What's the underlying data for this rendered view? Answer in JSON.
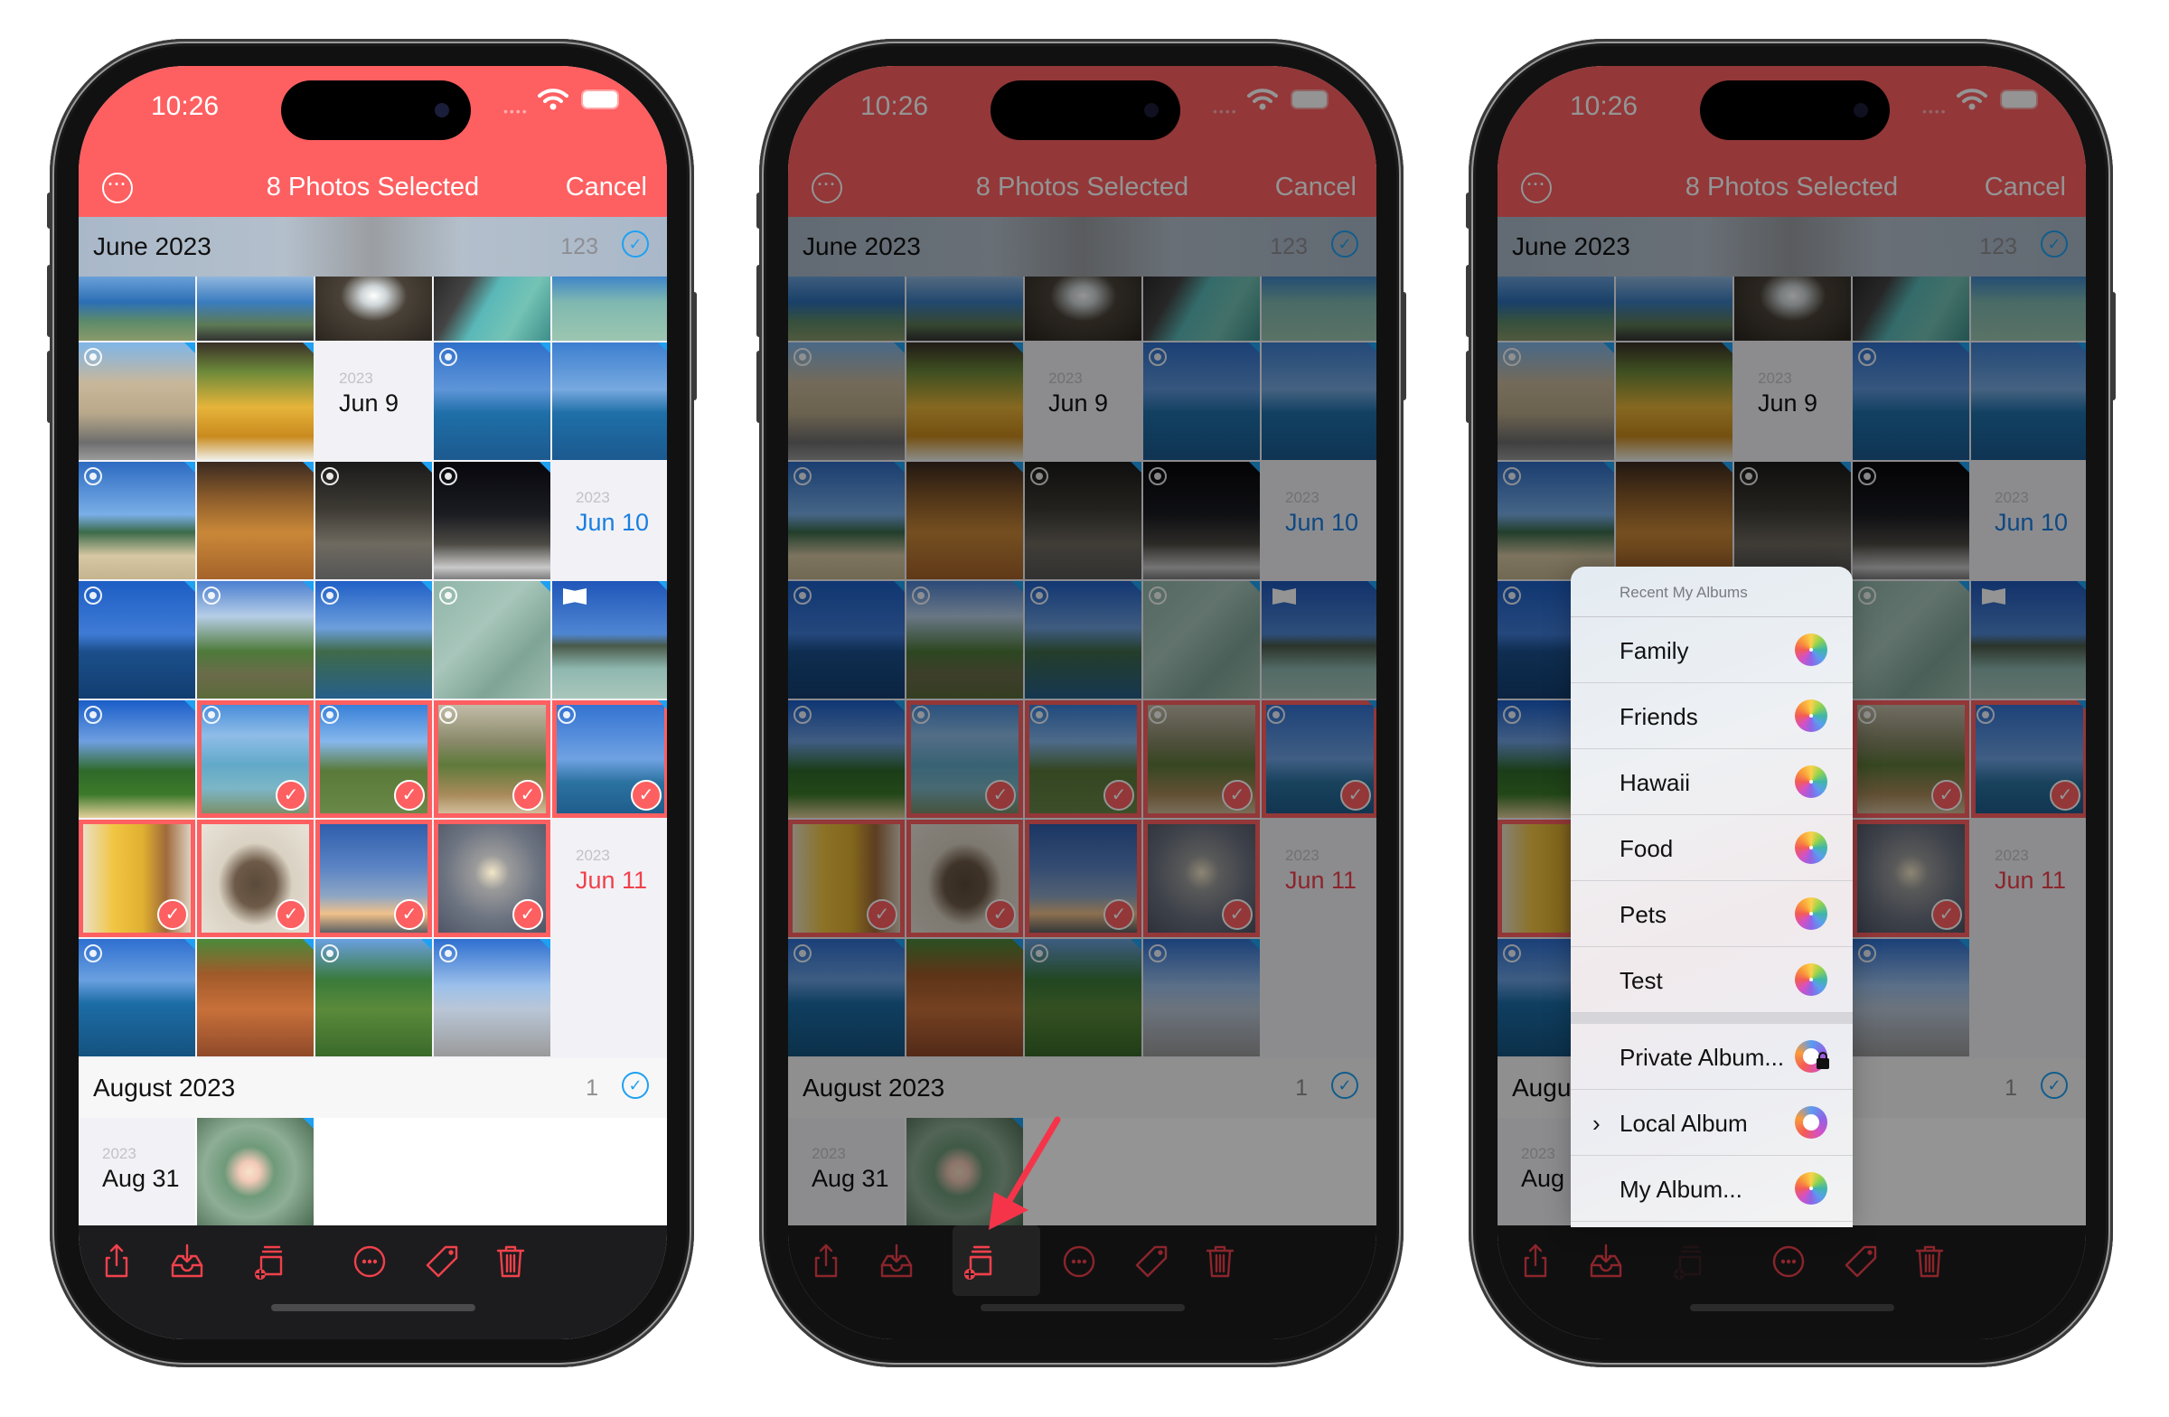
{
  "phones": [
    {
      "id": "phone-1",
      "state": "normal",
      "status_time": "10:26",
      "nav": {
        "title": "8 Photos Selected",
        "cancel": "Cancel"
      },
      "june": {
        "label": "June 2023",
        "count": "123"
      },
      "august": {
        "label": "August 2023",
        "count": "1"
      }
    },
    {
      "id": "phone-2",
      "state": "dimmed-highlight-add-to-album",
      "status_time": "10:26",
      "nav": {
        "title": "8 Photos Selected",
        "cancel": "Cancel"
      },
      "june": {
        "label": "June 2023",
        "count": "123"
      },
      "august": {
        "label": "August 2023",
        "count": "1"
      }
    },
    {
      "id": "phone-3",
      "state": "album-menu-open",
      "status_time": "10:26",
      "nav": {
        "title": "8 Photos Selected",
        "cancel": "Cancel"
      },
      "june": {
        "label": "June 2023",
        "count": "123"
      },
      "august": {
        "label": "August 2023",
        "count": "1"
      }
    }
  ],
  "date_cells": {
    "jun9": {
      "year": "2023",
      "date": "Jun 9",
      "color": "#111111"
    },
    "jun10": {
      "year": "2023",
      "date": "Jun 10",
      "color": "#1a7fe0"
    },
    "jun11": {
      "year": "2023",
      "date": "Jun 11",
      "color": "#f0414b"
    },
    "aug31": {
      "year": "2023",
      "date": "Aug 31",
      "color": "#111111"
    }
  },
  "selected_count": 8,
  "toolbar": {
    "icons": [
      "share-icon",
      "save-to-inbox-icon",
      "add-to-album-icon",
      "more-icon",
      "tag-icon",
      "trash-icon"
    ]
  },
  "album_menu": {
    "header": "Recent My Albums",
    "recent": [
      {
        "label": "Family",
        "icon": "photos-flower-icon"
      },
      {
        "label": "Friends",
        "icon": "photos-flower-icon"
      },
      {
        "label": "Hawaii",
        "icon": "photos-flower-icon"
      },
      {
        "label": "Food",
        "icon": "photos-flower-icon"
      },
      {
        "label": "Pets",
        "icon": "photos-flower-icon"
      },
      {
        "label": "Test",
        "icon": "photos-flower-icon"
      }
    ],
    "other": [
      {
        "label": "Private Album...",
        "icon": "private-album-lock-icon",
        "chevron": false
      },
      {
        "label": "Local Album",
        "icon": "local-album-ring-icon",
        "chevron": true
      },
      {
        "label": "My Album...",
        "icon": "photos-flower-icon",
        "chevron": false
      }
    ]
  },
  "colors": {
    "accent": "#fe5f61",
    "selection_check": "#1ea1f2",
    "toolbar_bg": "#1c1c1e"
  }
}
